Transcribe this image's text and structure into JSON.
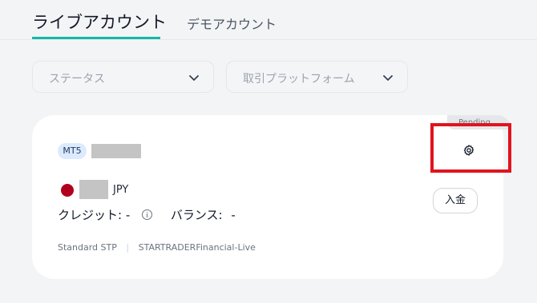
{
  "tabs": {
    "live": "ライブアカウント",
    "demo": "デモアカウント"
  },
  "filters": {
    "status_placeholder": "ステータス",
    "platform_placeholder": "取引プラットフォーム"
  },
  "account_card": {
    "platform_badge": "MT5",
    "status": "Pending",
    "currency": "JPY",
    "credit_label": "クレジット:",
    "credit_value": "-",
    "balance_label": "バランス:",
    "balance_value": "-",
    "deposit_button": "入金",
    "account_type": "Standard STP",
    "server": "STARTRADERFinancial-Live"
  },
  "colors": {
    "accent_underline": "#14b8a6",
    "highlight_box": "#e0141e",
    "badge_bg": "#dbeafe",
    "flag_red": "#b0001e"
  },
  "icons": {
    "filter_chevron": "chevron-down-icon",
    "settings": "gear-icon",
    "info": "info-icon",
    "flag": "japan-flag-icon"
  }
}
